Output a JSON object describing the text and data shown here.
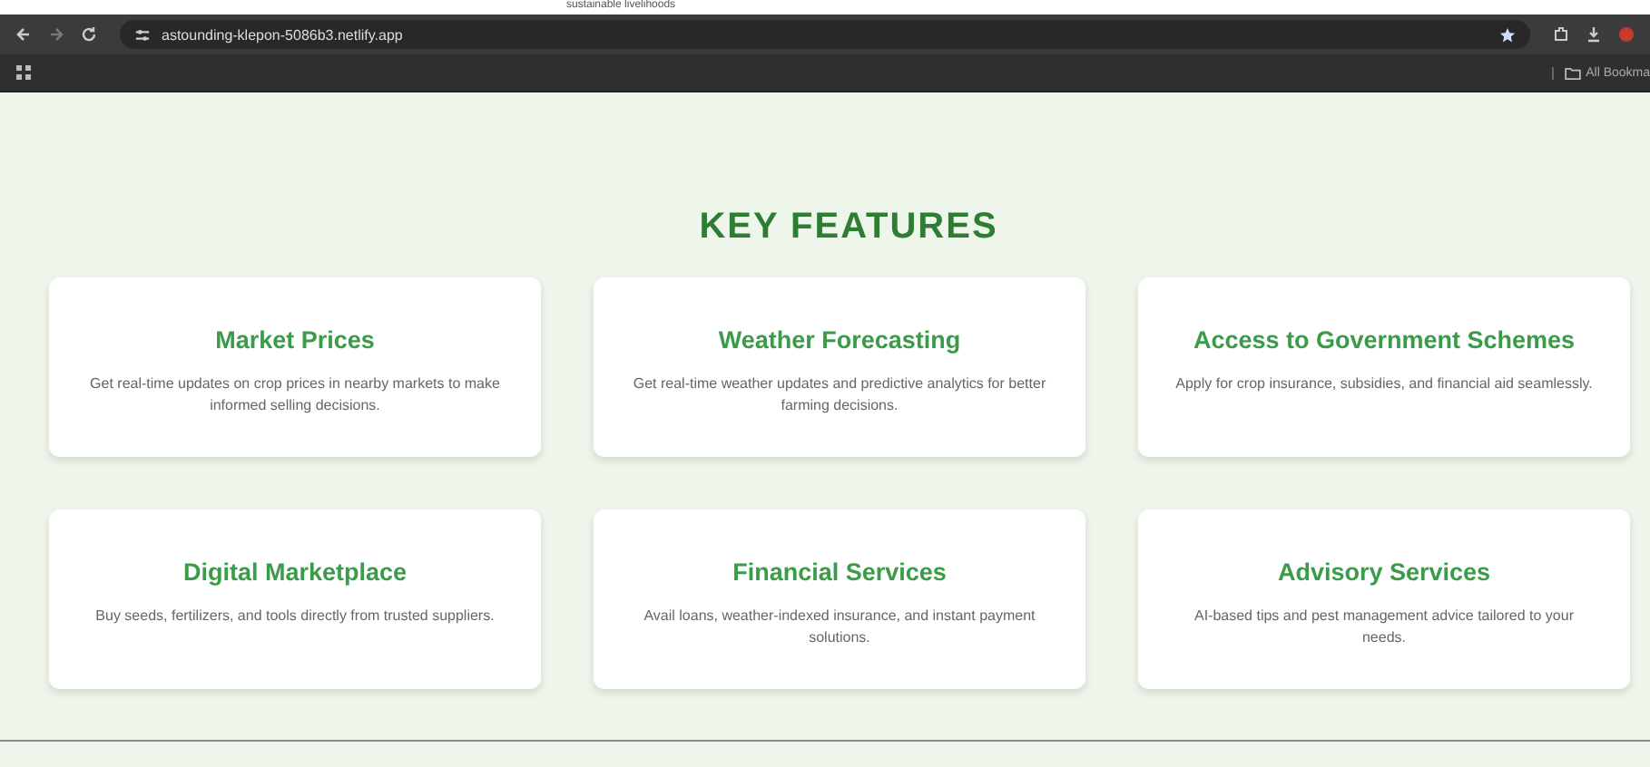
{
  "overlay_text": "sustainable livelihoods",
  "browser": {
    "url": "astounding-klepon-5086b3.netlify.app",
    "bookmarks_label": "All Bookma"
  },
  "section": {
    "title": "KEY FEATURES"
  },
  "features": [
    {
      "title": "Market Prices",
      "description": "Get real-time updates on crop prices in nearby markets to make informed selling decisions."
    },
    {
      "title": "Weather Forecasting",
      "description": "Get real-time weather updates and predictive analytics for better farming decisions."
    },
    {
      "title": "Access to Government Schemes",
      "description": "Apply for crop insurance, subsidies, and financial aid seamlessly."
    },
    {
      "title": "Digital Marketplace",
      "description": "Buy seeds, fertilizers, and tools directly from trusted suppliers."
    },
    {
      "title": "Financial Services",
      "description": "Avail loans, weather-indexed insurance, and instant payment solutions."
    },
    {
      "title": "Advisory Services",
      "description": "AI-based tips and pest management advice tailored to your needs."
    }
  ]
}
